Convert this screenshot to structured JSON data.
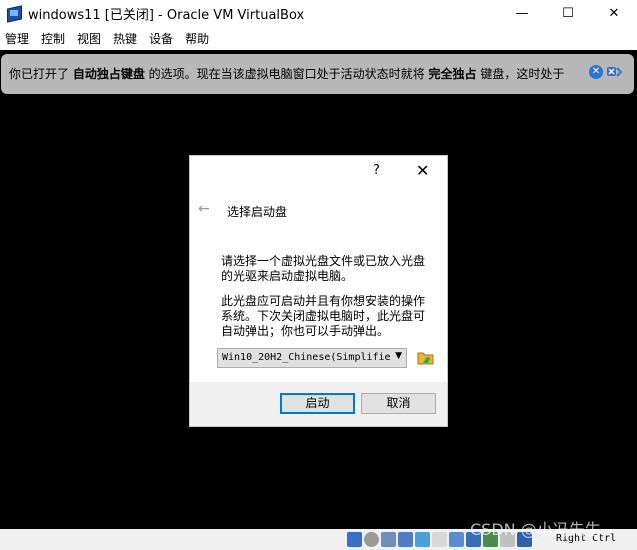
{
  "window": {
    "title": "windows11 [已关闭] - Oracle VM VirtualBox",
    "minimize_icon": "minimize-icon",
    "maximize_icon": "maximize-icon",
    "close_icon": "close-icon",
    "minimize_glyph": "—",
    "maximize_glyph": "☐",
    "close_glyph": "✕"
  },
  "menu": {
    "items": [
      "管理",
      "控制",
      "视图",
      "热键",
      "设备",
      "帮助"
    ]
  },
  "notice": {
    "text_a": "你已打开了 ",
    "bold_a": "自动独占键盘",
    "text_b": " 的选项。现在当该虚拟电脑窗口处于活动状态时就将 ",
    "bold_b": "完全独占",
    "text_c": " 键盘，这时处于",
    "close_glyph": "✕",
    "accent_color": "#2f73d6"
  },
  "dialog": {
    "help_label": "?",
    "close_glyph": "✕",
    "back_glyph": "←",
    "heading": "选择启动盘",
    "paragraph1": "请选择一个虚拟光盘文件或已放入光盘的光驱来启动虚拟电脑。",
    "paragraph2": "此光盘应可启动并且有你想安装的操作系统。下次关闭虚拟电脑时，此光盘可自动弹出；你也可以手动弹出。",
    "combo_value": "Win10_20H2_Chinese(Simplifie",
    "combo_arrow": "▼",
    "start_button": "启动",
    "cancel_button": "取消"
  },
  "status": {
    "host_key": "Right Ctrl",
    "watermark": "CSDN @小冯先生"
  }
}
